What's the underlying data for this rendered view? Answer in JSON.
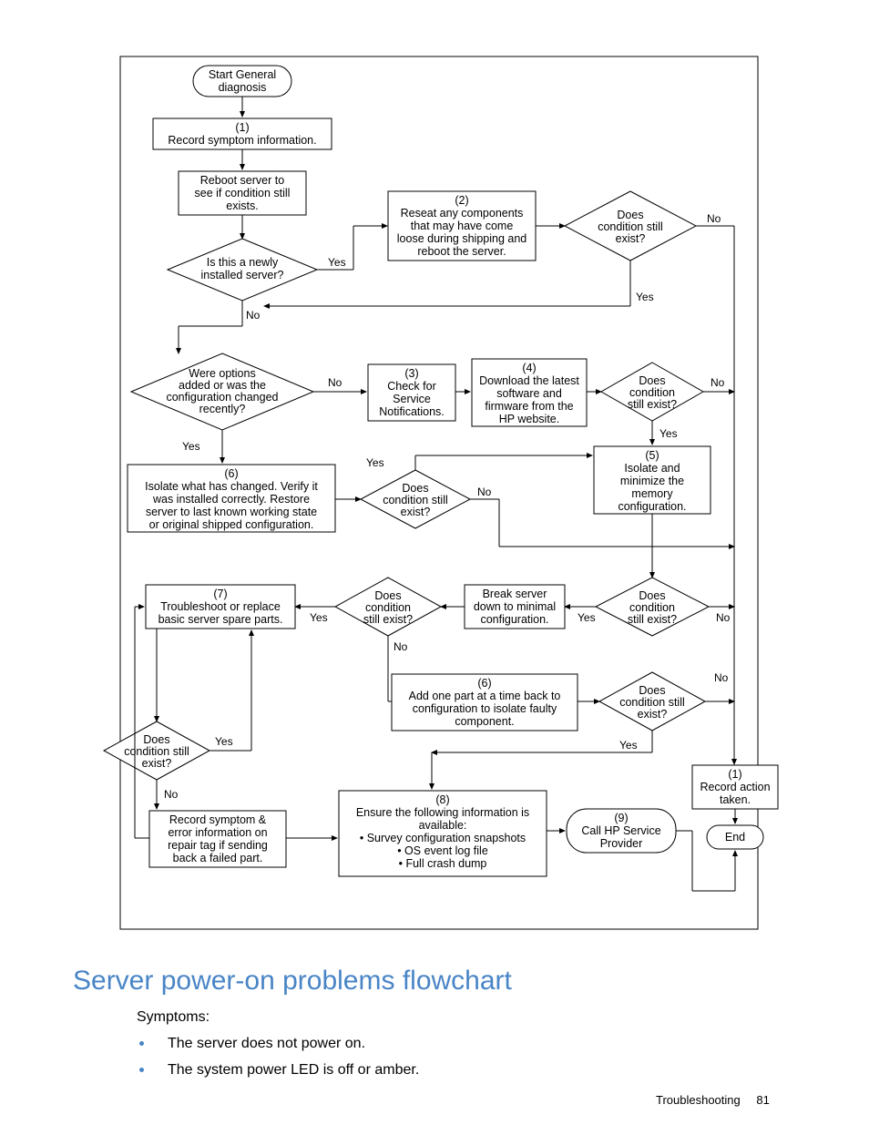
{
  "heading": "Server power-on problems flowchart",
  "symptoms_label": "Symptoms:",
  "symptoms": [
    "The server does not power on.",
    "The system power LED is off or amber."
  ],
  "footer_section": "Troubleshooting",
  "footer_page": "81",
  "nodes": {
    "start": [
      "Start General",
      "diagnosis"
    ],
    "n1": [
      "(1)",
      "Record symptom information."
    ],
    "reboot": [
      "Reboot server to",
      "see if condition still",
      "exists."
    ],
    "d_new": [
      "Is this a newly",
      "installed server?"
    ],
    "n2": [
      "(2)",
      "Reseat any components",
      "that may have come",
      "loose during shipping and",
      "reboot the server."
    ],
    "d_cond1": [
      "Does",
      "condition still",
      "exist?"
    ],
    "d_opts": [
      "Were options",
      "added or was the",
      "configuration changed",
      "recently?"
    ],
    "n3": [
      "(3)",
      "Check for",
      "Service",
      "Notifications."
    ],
    "n4": [
      "(4)",
      "Download the latest",
      "software and",
      "firmware from the",
      "HP website."
    ],
    "d_cond2": [
      "Does",
      "condition",
      "still exist?"
    ],
    "n5": [
      "(5)",
      "Isolate and",
      "minimize the",
      "memory",
      "configuration."
    ],
    "n6": [
      "(6)",
      "Isolate what has changed. Verify it",
      "was installed correctly.  Restore",
      "server to last known working state",
      "or original shipped configuration."
    ],
    "d_cond3": [
      "Does",
      "condition still",
      "exist?"
    ],
    "n7": [
      "(7)",
      "Troubleshoot or replace",
      "basic server spare parts."
    ],
    "d_cond4": [
      "Does",
      "condition",
      "still exist?"
    ],
    "break": [
      "Break server",
      "down to minimal",
      "configuration."
    ],
    "d_cond5": [
      "Does",
      "condition",
      "still exist?"
    ],
    "n6b": [
      "(6)",
      "Add one part at a time back to",
      "configuration to isolate faulty",
      "component."
    ],
    "d_cond6": [
      "Does",
      "condition still",
      "exist?"
    ],
    "d_cond7": [
      "Does",
      "condition still",
      "exist?"
    ],
    "record_action": [
      "(1)",
      "Record action",
      "taken."
    ],
    "record_err": [
      "Record symptom &",
      "error information on",
      "repair tag if sending",
      "back a failed part."
    ],
    "n8": [
      "(8)",
      "Ensure the following information is",
      "available:",
      "• Survey configuration snapshots",
      "• OS event log file",
      "• Full crash dump"
    ],
    "n9": [
      "(9)",
      "Call HP Service",
      "Provider"
    ],
    "end": [
      "End"
    ]
  },
  "labels": {
    "yes": "Yes",
    "no": "No"
  }
}
